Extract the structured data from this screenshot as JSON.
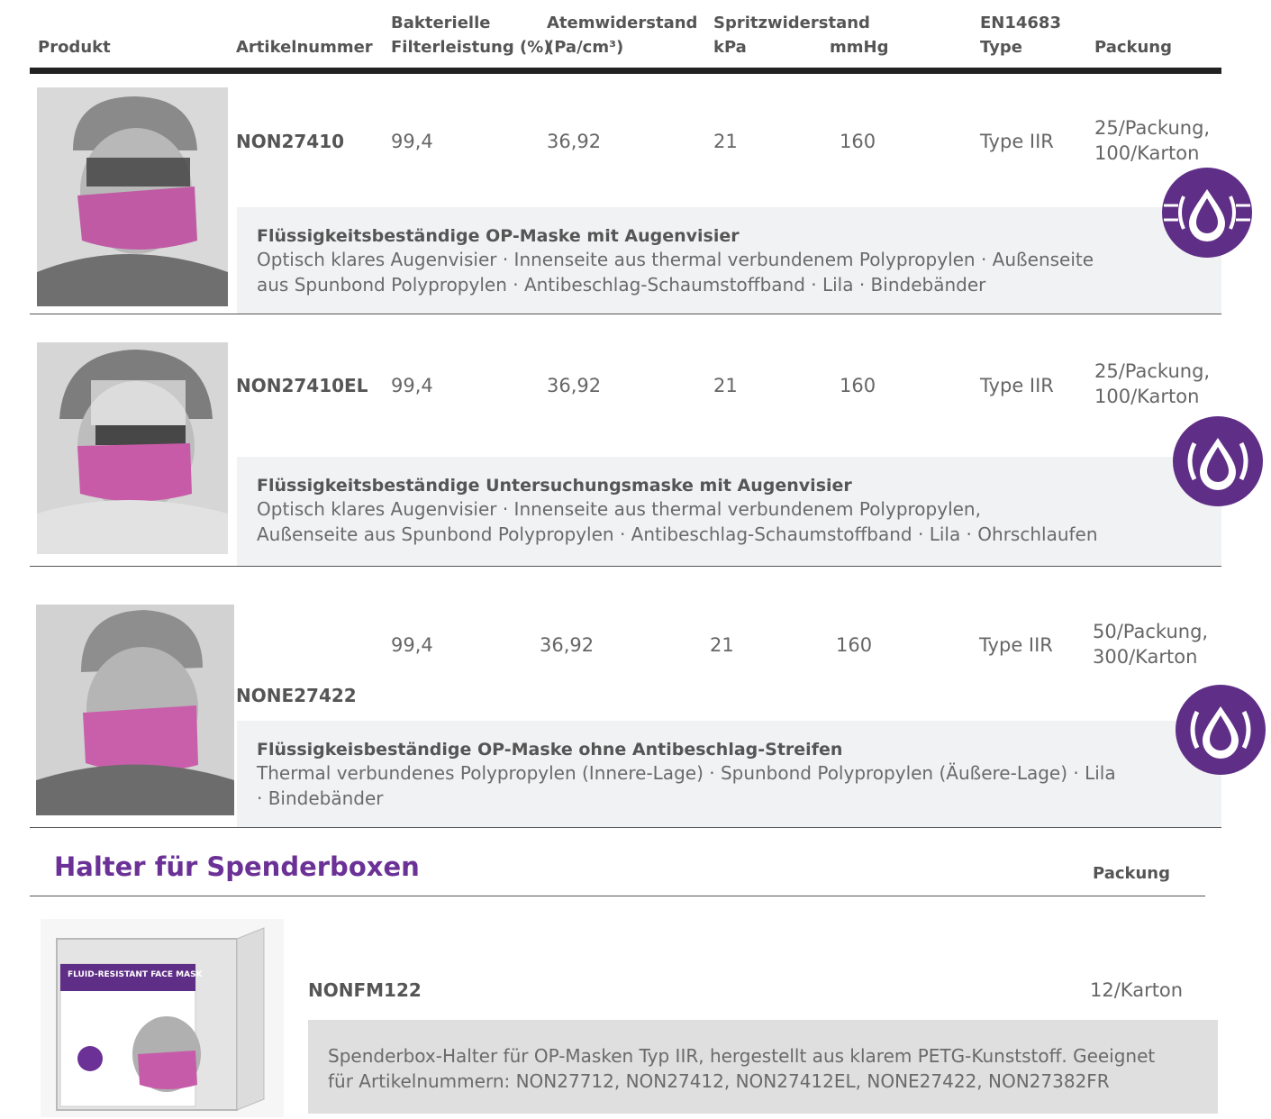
{
  "header": {
    "produkt": "Produkt",
    "artikelnummer": "Artikelnummer",
    "bakterielle_1": "Bakterielle",
    "bakterielle_2": "Filterleistung (%)",
    "atem_1": "Atemwiderstand",
    "atem_2": "(Pa/cm³)",
    "spritz_1": "Spritzwiderstand",
    "spritz_kpa": "kPa",
    "spritz_mmhg": "mmHg",
    "en_1": "EN14683",
    "en_2": "Type",
    "packung": "Packung"
  },
  "products": [
    {
      "artikel": "NON27410",
      "bfe": "99,4",
      "atem": "36,92",
      "kpa": "21",
      "mmhg": "160",
      "type": "Type IIR",
      "pack_1": "25/Packung,",
      "pack_2": "100/Karton",
      "title": "Flüssigkeitsbeständige OP-Maske mit Augenvisier",
      "desc_1": "Optisch klares Augenvisier · Innenseite aus thermal verbundenem Polypropylen · Außenseite",
      "desc_2": "aus Spunbond Polypropylen · Antibeschlag-Schaumstoffband · Lila · Bindebänder"
    },
    {
      "artikel": "NON27410EL",
      "bfe": "99,4",
      "atem": "36,92",
      "kpa": "21",
      "mmhg": "160",
      "type": "Type IIR",
      "pack_1": "25/Packung,",
      "pack_2": "100/Karton",
      "title": "Flüssigkeitsbeständige Untersuchungsmaske mit Augenvisier",
      "desc_1": "Optisch klares Augenvisier · Innenseite aus thermal verbundenem Polypropylen,",
      "desc_2": "Außenseite aus Spunbond Polypropylen · Antibeschlag-Schaumstoffband · Lila · Ohrschlaufen"
    },
    {
      "artikel": "NONE27422",
      "bfe": "99,4",
      "atem": "36,92",
      "kpa": "21",
      "mmhg": "160",
      "type": "Type IIR",
      "pack_1": "50/Packung,",
      "pack_2": "300/Karton",
      "title": "Flüssigkeisbeständige OP-Maske ohne Antibeschlag-Streifen",
      "desc_1": "Thermal verbundenes Polypropylen (Innere-Lage) · Spunbond Polypropylen (Äußere-Lage) · Lila",
      "desc_2": "· Bindebänder"
    }
  ],
  "holder": {
    "section_title": "Halter für Spenderboxen",
    "packung_header": "Packung",
    "artikel": "NONFM122",
    "pack": "12/Karton",
    "desc_1": "Spenderbox-Halter für OP-Masken Typ IIR, hergestellt aus klarem PETG-Kunststoff. Geeignet",
    "desc_2": "für Artikelnummern: NON27712, NON27412, NON27412EL, NONE27422, NON27382FR",
    "box_label": "FLUID-RESISTANT FACE MASK"
  },
  "colors": {
    "badge": "#5f2e86",
    "title": "#6b3196",
    "panel": "#f1f2f4"
  }
}
